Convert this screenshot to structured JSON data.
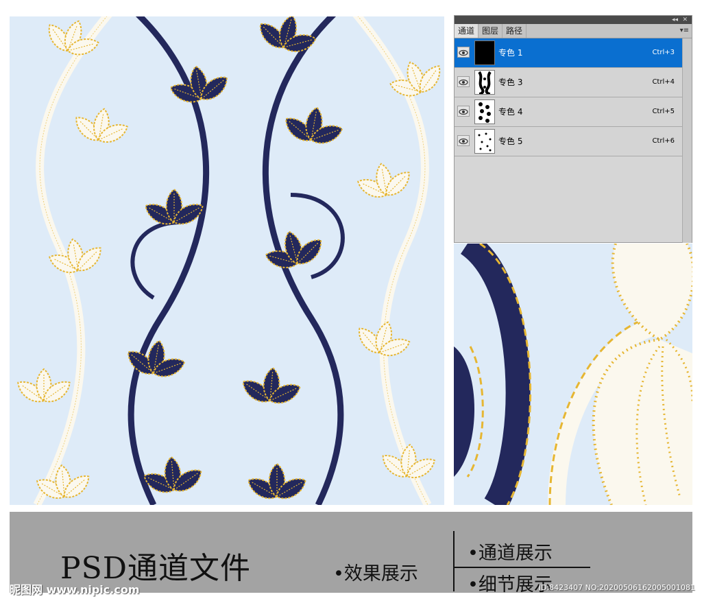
{
  "panel": {
    "collapse_glyph": "◂◂",
    "close_glyph": "✕",
    "menu_glyph": "▾≡",
    "tabs": [
      "通道",
      "图层",
      "路径"
    ],
    "channels": [
      {
        "name": "专色 1",
        "shortcut": "Ctrl+3",
        "selected": true
      },
      {
        "name": "专色 3",
        "shortcut": "Ctrl+4",
        "selected": false
      },
      {
        "name": "专色 4",
        "shortcut": "Ctrl+5",
        "selected": false
      },
      {
        "name": "专色 5",
        "shortcut": "Ctrl+6",
        "selected": false
      }
    ]
  },
  "banner": {
    "title": "PSD通道文件",
    "items": [
      "•效果展示",
      "•通道展示",
      "•细节展示"
    ]
  },
  "watermark": {
    "site": "昵图网 www.nipic.com",
    "id": "ID:8423407 NO:20200506162005001081"
  },
  "colors": {
    "background": "#deebf8",
    "navy": "#23285c",
    "gold": "#e6b632",
    "cream": "#fbf8ee",
    "selection": "#0a6fd0"
  }
}
